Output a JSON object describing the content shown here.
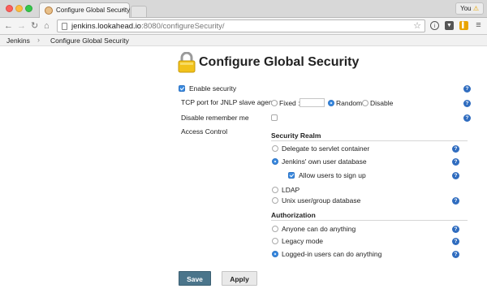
{
  "browser": {
    "tab_title": "Configure Global Security",
    "tab_close": "×",
    "user_label": "You",
    "url_host": "jenkins.lookahead.io",
    "url_rest": ":8080/configureSecurity/"
  },
  "breadcrumbs": [
    "Jenkins",
    "Configure Global Security"
  ],
  "breadcrumb_separator": "›",
  "page": {
    "title": "Configure Global Security"
  },
  "form": {
    "enable_security": {
      "label": "Enable security",
      "checked": true
    },
    "jnlp_port": {
      "label": "TCP port for JNLP slave agents",
      "options": [
        "Fixed :",
        "Random",
        "Disable"
      ],
      "selected": "Random",
      "fixed_value": ""
    },
    "disable_remember_me": {
      "label": "Disable remember me",
      "checked": false
    },
    "access_control": {
      "label": "Access Control",
      "security_realm": {
        "heading": "Security Realm",
        "options": [
          "Delegate to servlet container",
          "Jenkins' own user database",
          "LDAP",
          "Unix user/group database"
        ],
        "selected": "Jenkins' own user database",
        "allow_signup": {
          "label": "Allow users to sign up",
          "checked": true
        }
      },
      "authorization": {
        "heading": "Authorization",
        "options": [
          "Anyone can do anything",
          "Legacy mode",
          "Logged-in users can do anything"
        ],
        "selected": "Logged-in users can do anything"
      }
    },
    "help_glyph": "?"
  },
  "buttons": {
    "save": "Save",
    "apply": "Apply"
  },
  "colors": {
    "accent": "#3b8be0",
    "save_button": "#4b758b",
    "help_icon": "#2f6cbf"
  }
}
